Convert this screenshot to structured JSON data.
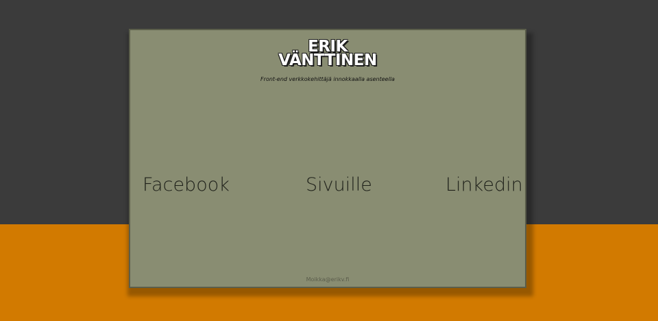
{
  "logo": {
    "line1": "ERIK",
    "line2": "VÄNTTINEN"
  },
  "tagline": "Front-end verkkokehittäjä innokkaalla asenteella",
  "nav": {
    "facebook": "Facebook",
    "sivuille": "Sivuille",
    "linkedin": "Linkedin"
  },
  "footer": {
    "email": "Moikka@erikv.fi"
  },
  "colors": {
    "background_top": "#3b3b3b",
    "background_bottom": "#d27a00",
    "card": "#898d72",
    "card_border": "#5b5e4b"
  }
}
